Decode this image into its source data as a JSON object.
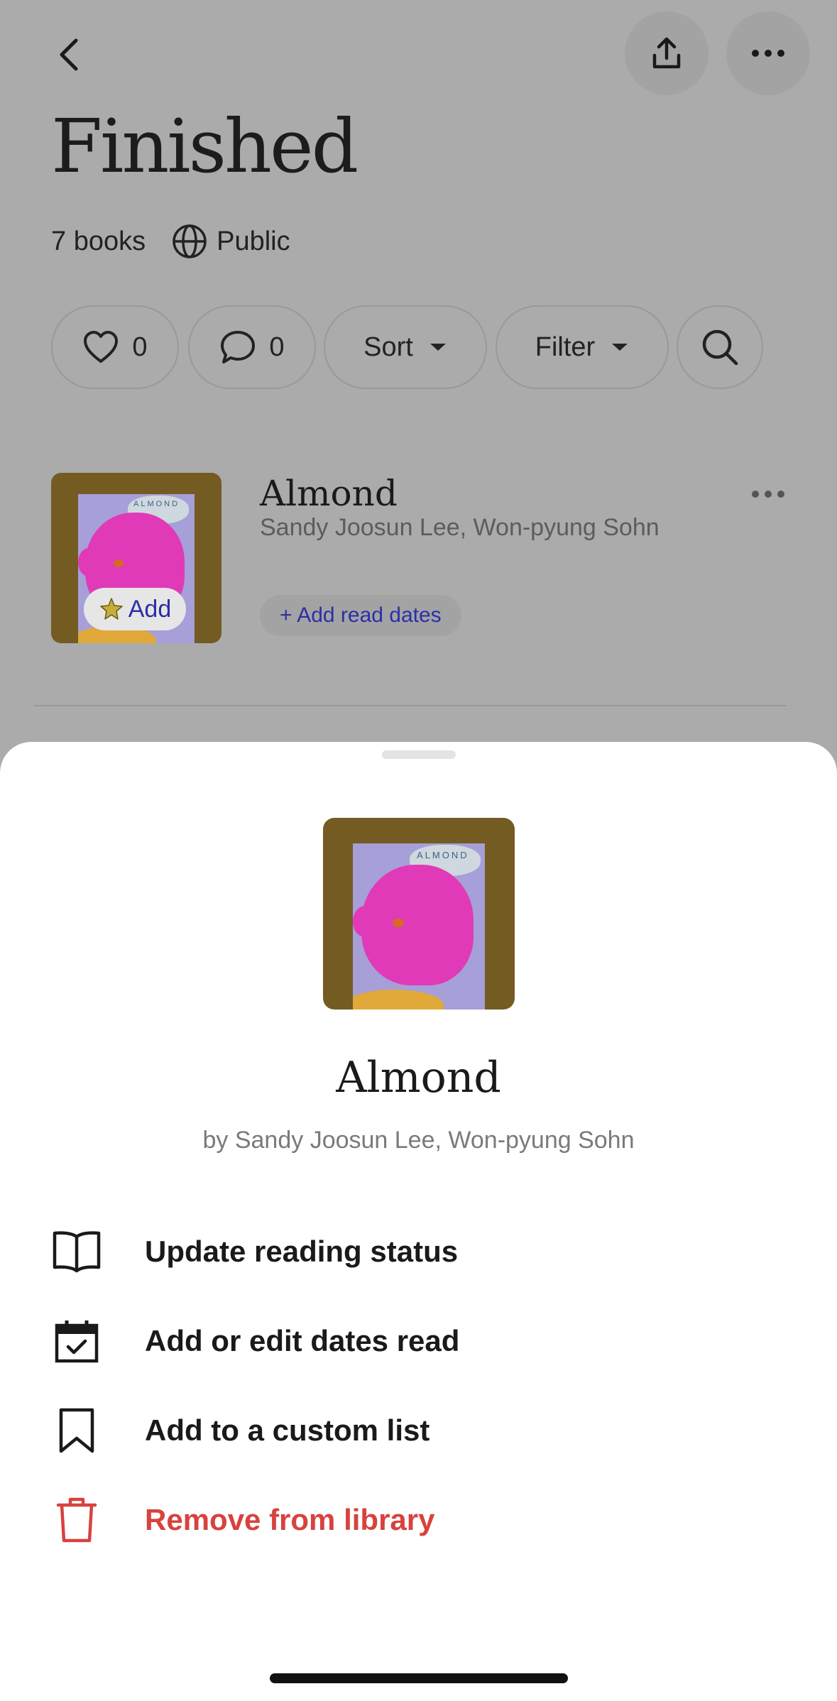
{
  "page": {
    "title": "Finished",
    "book_count": "7 books",
    "visibility": "Public"
  },
  "toolbar": {
    "likes": "0",
    "comments": "0",
    "sort_label": "Sort",
    "filter_label": "Filter"
  },
  "list_item": {
    "title": "Almond",
    "authors": "Sandy Joosun Lee, Won-pyung Sohn",
    "add_badge": "Add",
    "add_read_dates": "+ Add read dates",
    "cover_text": "ALMOND"
  },
  "sheet": {
    "title": "Almond",
    "byline": "by Sandy Joosun Lee, Won-pyung Sohn",
    "actions": [
      {
        "label": "Update reading status",
        "icon": "open-book-icon"
      },
      {
        "label": "Add or edit dates read",
        "icon": "calendar-check-icon"
      },
      {
        "label": "Add to a custom list",
        "icon": "bookmark-icon"
      },
      {
        "label": "Remove from library",
        "icon": "trash-icon"
      }
    ]
  },
  "colors": {
    "overlay_bg": "#ababab",
    "danger": "#d8423e",
    "link": "#2b2fa8",
    "cover_frame": "#735b22"
  }
}
